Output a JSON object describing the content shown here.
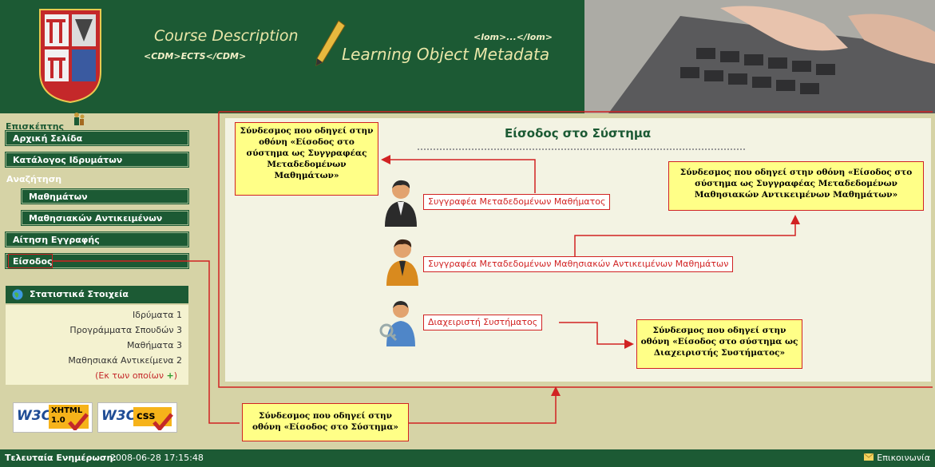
{
  "header": {
    "course_title": "Course Description",
    "course_tag": "<CDM>ECTS</CDM>",
    "lom_tag": "<lom>...</lom>",
    "lom_title": "Learning Object Metadata"
  },
  "sidebar": {
    "visitor_label": "Επισκέπτης",
    "nav": [
      {
        "label": "Αρχική Σελίδα"
      },
      {
        "label": "Κατάλογος Ιδρυμάτων"
      },
      {
        "label": "Αναζήτηση"
      },
      {
        "label": "Μαθημάτων"
      },
      {
        "label": "Μαθησιακών Αντικειμένων"
      },
      {
        "label": "Αίτηση Εγγραφής"
      },
      {
        "label": "Είσοδος"
      }
    ],
    "stats": {
      "title": "Στατιστικά Στοιχεία",
      "rows": [
        "Ιδρύματα 1",
        "Προγράμματα Σπουδών 3",
        "Μαθήματα 3",
        "Μαθησιακά Αντικείμενα 2"
      ],
      "more": "(Εκ των οποίων",
      "more_plus": "+)"
    },
    "badges": {
      "xhtml": {
        "w3c": "W3C",
        "name": "XHTML",
        "version": "1.0"
      },
      "css": {
        "w3c": "W3C",
        "name": "css"
      }
    }
  },
  "main": {
    "title": "Είσοδος στο Σύστημα",
    "links": {
      "course_author": "Συγγραφέα Μεταδεδομένων Μαθήματος",
      "lo_author": "Συγγραφέα Μεταδεδομένων Μαθησιακών Αντικειμένων Μαθημάτων",
      "admin": "Διαχειριστή Συστήματος"
    },
    "notes": {
      "course_author": "Σύνδεσμος που οδηγεί στην οθόνη «Είσοδος στο σύστημα ως Συγγραφέας Μεταδεδομένων Μαθημάτων»",
      "lo_author": "Σύνδεσμος που οδηγεί στην οθόνη «Είσοδος στο σύστημα ως Συγγραφέας Μεταδεδομένων Μαθησιακών Αντικειμένων Μαθημάτων»",
      "admin": "Σύνδεσμος που οδηγεί στην οθόνη «Είσοδος στο σύστημα ως Διαχειριστής Συστήματος»",
      "login": "Σύνδεσμος που οδηγεί στην οθόνη «Είσοδος στο Σύστημα»"
    }
  },
  "footer": {
    "updated_label": "Τελευταία Ενημέρωση:",
    "updated_value": "2008-06-28 17:15:48",
    "contact": "Επικοινωνία"
  },
  "colors": {
    "brand_green": "#1c5a34",
    "page_bg": "#d6d3a6",
    "annotation_red": "#d12222",
    "note_yellow": "#ffff87"
  }
}
